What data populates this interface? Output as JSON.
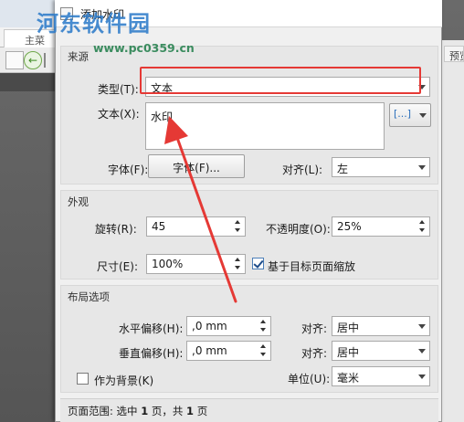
{
  "background": {
    "tab_label": "主菜",
    "right_tab_label": "预览",
    "nav_back_glyph": "←"
  },
  "dialog": {
    "title": "添加水印"
  },
  "watermark": {
    "site_name": "河东软件园",
    "url": "www.pc0359.cn"
  },
  "source": {
    "title": "来源",
    "type_label": "类型(T):",
    "type_value": "文本",
    "text_label": "文本(X):",
    "text_value": "水印",
    "insert_glyph": "[...]",
    "font_label": "字体(F):",
    "font_button": "字体(F)...",
    "align_label": "对齐(L):",
    "align_value": "左"
  },
  "appearance": {
    "title": "外观",
    "rotation_label": "旋转(R):",
    "rotation_value": "45",
    "opacity_label": "不透明度(O):",
    "opacity_value": "25%",
    "size_label": "尺寸(E):",
    "size_value": "100%",
    "scale_checkbox_label": "基于目标页面缩放",
    "scale_checked": true
  },
  "layout": {
    "title": "布局选项",
    "h_offset_label": "水平偏移(H):",
    "h_offset_value": ",0 mm",
    "h_align_label": "对齐:",
    "h_align_value": "居中",
    "v_offset_label": "垂直偏移(H):",
    "v_offset_value": ",0 mm",
    "v_align_label": "对齐:",
    "v_align_value": "居中",
    "background_checkbox_label": "作为背景(K)",
    "background_checked": false,
    "unit_label": "单位(U):",
    "unit_value": "毫米"
  },
  "page_range": {
    "prefix": "页面范围: 选中",
    "selected": "1",
    "middle": "页，共",
    "total": "1",
    "suffix": "页"
  },
  "colors": {
    "highlight_red": "#e53935",
    "dialog_bg": "#f0f0f0"
  }
}
